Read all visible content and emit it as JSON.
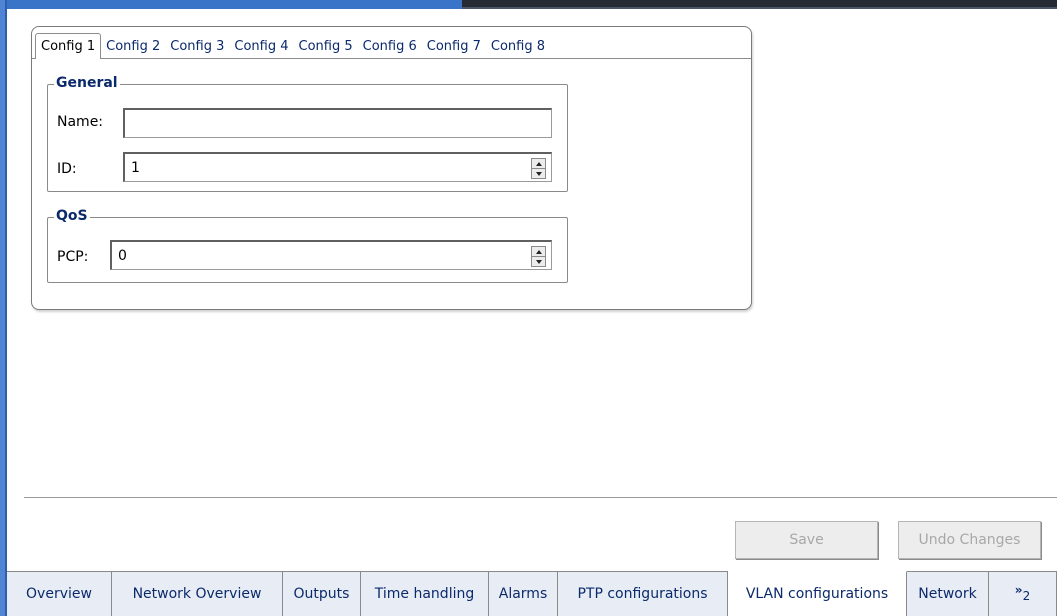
{
  "config_tabs": [
    {
      "label": "Config 1",
      "active": true
    },
    {
      "label": "Config 2"
    },
    {
      "label": "Config 3"
    },
    {
      "label": "Config 4"
    },
    {
      "label": "Config 5"
    },
    {
      "label": "Config 6"
    },
    {
      "label": "Config 7"
    },
    {
      "label": "Config 8"
    }
  ],
  "general": {
    "legend": "General",
    "name_label": "Name:",
    "name_value": "",
    "id_label": "ID:",
    "id_value": "1"
  },
  "qos": {
    "legend": "QoS",
    "pcp_label": "PCP:",
    "pcp_value": "0"
  },
  "actions": {
    "save_label": "Save",
    "undo_label": "Undo Changes"
  },
  "bottom_tabs": [
    {
      "label": "Overview"
    },
    {
      "label": "Network Overview"
    },
    {
      "label": "Outputs"
    },
    {
      "label": "Time handling"
    },
    {
      "label": "Alarms"
    },
    {
      "label": "PTP configurations"
    },
    {
      "label": "VLAN configurations",
      "active": true
    },
    {
      "label": "Network"
    }
  ],
  "more_tabs": {
    "glyph": "»",
    "count": "2"
  },
  "colors": {
    "accent": "#3a74c9",
    "tab_text": "#0b2a6b",
    "disabled_text": "#a8a8a8"
  }
}
